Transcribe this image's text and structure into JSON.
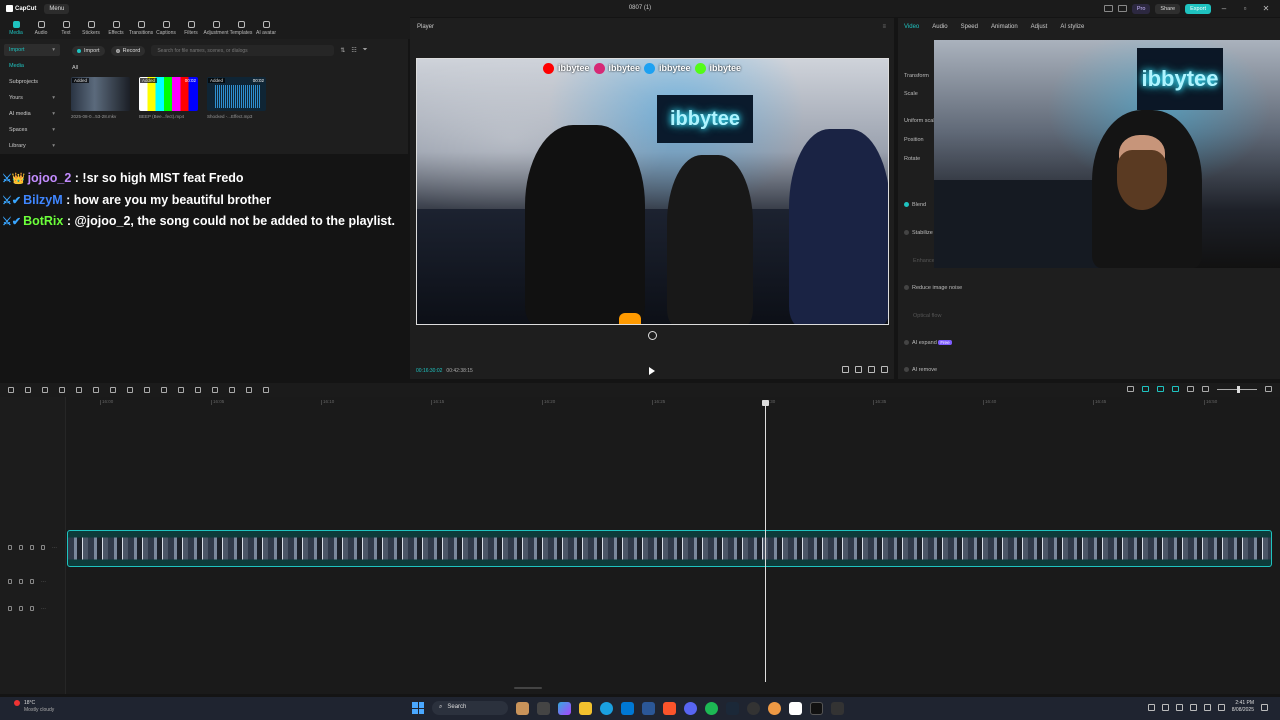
{
  "titlebar": {
    "app_name": "CapCut",
    "menu_label": "Menu",
    "project_title": "0807 (1)",
    "pro_label": "Pro",
    "share_label": "Share",
    "export_label": "Export"
  },
  "toolbar": {
    "tools": [
      "Media",
      "Audio",
      "Text",
      "Stickers",
      "Effects",
      "Transitions",
      "Captions",
      "Filters",
      "Adjustment",
      "Templates",
      "AI avatar"
    ]
  },
  "media": {
    "sidebar": [
      {
        "label": "Import",
        "chev": "▾"
      },
      {
        "label": "Media",
        "chev": ""
      },
      {
        "label": "Subprojects",
        "chev": ""
      },
      {
        "label": "Yours",
        "chev": "▾"
      },
      {
        "label": "AI media",
        "chev": "▾"
      },
      {
        "label": "Spaces",
        "chev": "▾"
      },
      {
        "label": "Library",
        "chev": "▾"
      }
    ],
    "import_button": "Import",
    "record_button": "Record",
    "search_placeholder": "Search for file names, scenes, or dialogs",
    "all_label": "All",
    "items": [
      {
        "badge": "Added",
        "duration": "",
        "filename": "2025-08-0...53-28.mkv"
      },
      {
        "badge": "Added",
        "duration": "00:02",
        "filename": "BEEP (Bee...fect).mp4"
      },
      {
        "badge": "Added",
        "duration": "00:02",
        "filename": "Shocked -...Effect.mp3"
      }
    ]
  },
  "chat": [
    {
      "user": "jojoo_2",
      "message": " : !sr so high MIST feat Fredo"
    },
    {
      "user": "BilzyM",
      "message": " : how are you my beautiful brother"
    },
    {
      "user": "BotRix",
      "message": " : @jojoo_2, the song could not be added to the playlist."
    }
  ],
  "player": {
    "title": "Player",
    "social_handle": "ibbytee",
    "neon_sign": "ibbytee",
    "timecode_current": "00:16:30:02",
    "timecode_total": "00:42:38:15"
  },
  "inspector": {
    "tabs": [
      "Video",
      "Audio",
      "Speed",
      "Animation",
      "Adjust",
      "AI stylize"
    ],
    "rows": {
      "transform": "Transform",
      "scale": "Scale",
      "uniform_scale": "Uniform scale",
      "position": "Position",
      "rotate": "Rotate",
      "blend": "Blend",
      "stabilize": "Stabilize",
      "enhance": "Enhance",
      "reduce_noise": "Reduce image noise",
      "optical_flow": "Optical flow",
      "ai_expand": "AI expand",
      "ai_expand_badge": "Free",
      "ai_remove": "AI remove"
    },
    "webcam_sign": "ibbytee"
  },
  "timeline": {
    "ruler_ticks": [
      "16:00",
      "16:05",
      "16:10",
      "16:15",
      "16:20",
      "16:25",
      "16:30",
      "16:35",
      "16:40",
      "16:45",
      "16:50"
    ]
  },
  "taskbar": {
    "temperature": "18°C",
    "condition": "Mostly cloudy",
    "search_label": "Search",
    "time": "2:41 PM",
    "date": "8/08/2025",
    "colors": {
      "accent": "#1fc3c0",
      "bg": "#1f2430"
    }
  }
}
